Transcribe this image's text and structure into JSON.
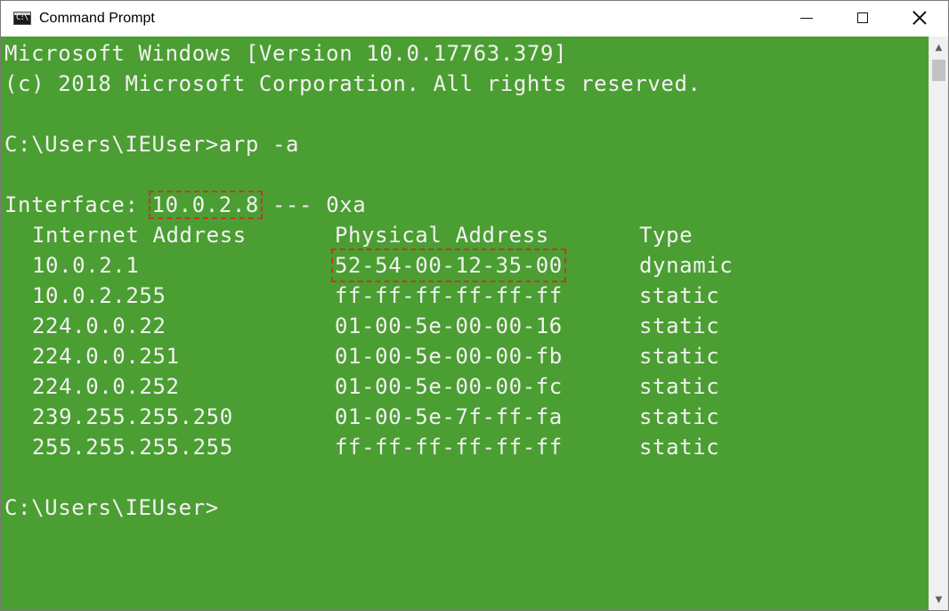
{
  "window": {
    "title": "Command Prompt",
    "icon_glyph": "C:\\"
  },
  "console": {
    "lines": [
      "Microsoft Windows [Version 10.0.17763.379]",
      "(c) 2018 Microsoft Corporation. All rights reserved.",
      "",
      "C:\\Users\\IEUser>arp -a",
      "",
      "C:\\Users\\IEUser>"
    ],
    "interface": {
      "prefix": "Interface: ",
      "ip": "10.0.2.8",
      "suffix": " --- 0xa"
    },
    "headers": {
      "internet": "Internet Address",
      "physical": "Physical Address",
      "type": "Type"
    },
    "entries": [
      {
        "internet": "10.0.2.1",
        "physical": "52-54-00-12-35-00",
        "type": "dynamic"
      },
      {
        "internet": "10.0.2.255",
        "physical": "ff-ff-ff-ff-ff-ff",
        "type": "static"
      },
      {
        "internet": "224.0.0.22",
        "physical": "01-00-5e-00-00-16",
        "type": "static"
      },
      {
        "internet": "224.0.0.251",
        "physical": "01-00-5e-00-00-fb",
        "type": "static"
      },
      {
        "internet": "224.0.0.252",
        "physical": "01-00-5e-00-00-fc",
        "type": "static"
      },
      {
        "internet": "239.255.255.250",
        "physical": "01-00-5e-7f-ff-fa",
        "type": "static"
      },
      {
        "internet": "255.255.255.255",
        "physical": "ff-ff-ff-ff-ff-ff",
        "type": "static"
      }
    ]
  },
  "colors": {
    "console_background": "#4b9e32",
    "console_text": "#f2f2f2",
    "highlight_border": "#c0392b"
  },
  "icons": {
    "app": "command-prompt-icon",
    "minimize": "minimize-icon",
    "maximize": "maximize-icon",
    "close": "close-icon",
    "scroll_up": "scroll-up-arrow-icon",
    "scroll_down": "scroll-down-arrow-icon"
  }
}
